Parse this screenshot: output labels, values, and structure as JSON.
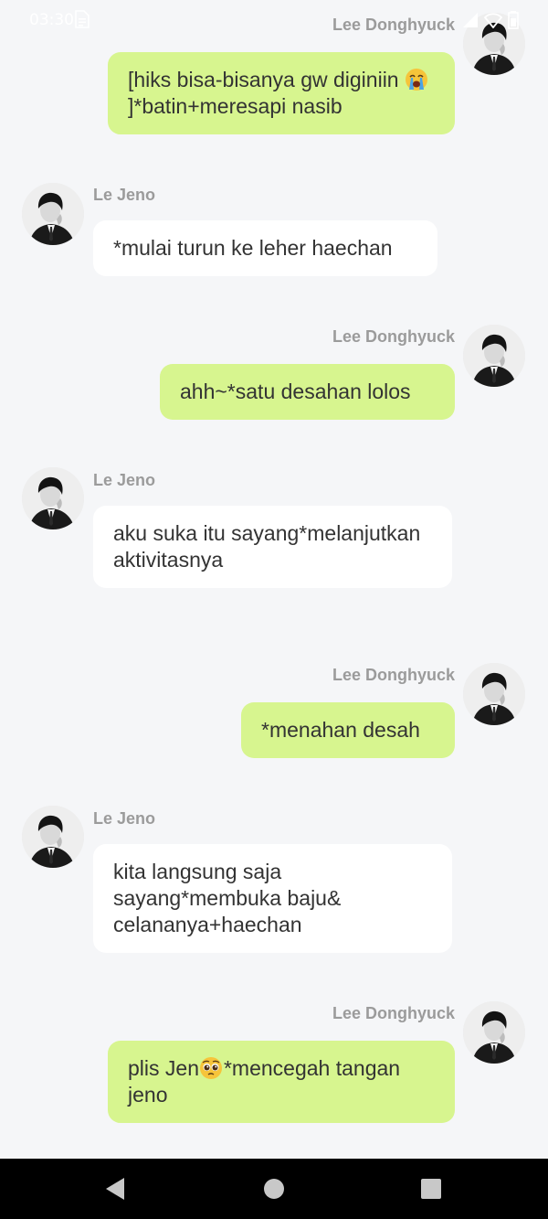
{
  "status_bar": {
    "time": "03:30",
    "icons": [
      "document-icon",
      "signal-icon",
      "wifi-icon",
      "battery-icon"
    ]
  },
  "colors": {
    "outgoing_bubble": "#d7f58f",
    "incoming_bubble": "#ffffff",
    "background": "#f5f6f8",
    "sender_name": "#9b9b9b"
  },
  "messages": [
    {
      "side": "right",
      "sender": "Lee Donghyuck",
      "text_before_emoji": "[hiks bisa-bisanya gw diginiin ",
      "emoji": "loudly-crying-face-icon",
      "text_after_emoji": "]*batin+meresapi nasib"
    },
    {
      "side": "left",
      "sender": "Le Jeno",
      "text": "*mulai turun ke leher haechan"
    },
    {
      "side": "right",
      "sender": "Lee Donghyuck",
      "text": "ahh~*satu desahan lolos"
    },
    {
      "side": "left",
      "sender": "Le Jeno",
      "text": "aku suka itu sayang*melanjutkan aktivitasnya"
    },
    {
      "side": "right",
      "sender": "Lee Donghyuck",
      "text": "*menahan desah"
    },
    {
      "side": "left",
      "sender": "Le Jeno",
      "text": "kita langsung saja sayang*membuka baju& celananya+haechan"
    },
    {
      "side": "right",
      "sender": "Lee Donghyuck",
      "text_before_emoji": "plis Jen",
      "emoji": "pleading-face-icon",
      "text_after_emoji": "*mencegah tangan jeno"
    }
  ],
  "nav_bar": {
    "buttons": [
      "back-button",
      "home-button",
      "recents-button"
    ]
  }
}
